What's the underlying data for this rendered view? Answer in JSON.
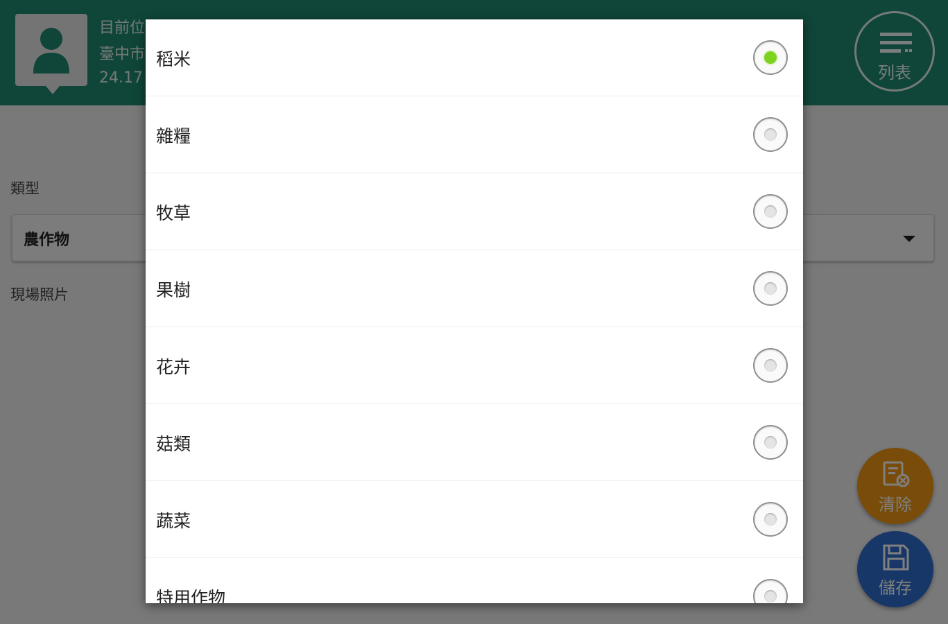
{
  "header": {
    "location_line1": "目前位置",
    "location_line2": "臺中市",
    "location_line3": "24.17",
    "list_button_label": "列表"
  },
  "form": {
    "type_label": "類型",
    "type_value": "農作物",
    "photo_label": "現場照片"
  },
  "fabs": {
    "clear_label": "清除",
    "save_label": "儲存"
  },
  "dialog": {
    "selected_index": 0,
    "options": [
      {
        "label": "稻米",
        "checked": true
      },
      {
        "label": "雜糧",
        "checked": false
      },
      {
        "label": "牧草",
        "checked": false
      },
      {
        "label": "果樹",
        "checked": false
      },
      {
        "label": "花卉",
        "checked": false
      },
      {
        "label": "菇類",
        "checked": false
      },
      {
        "label": "蔬菜",
        "checked": false
      },
      {
        "label": "特用作物",
        "checked": false
      }
    ]
  },
  "colors": {
    "header": "#1f8c72",
    "clear_fab": "#f39a12",
    "save_fab": "#2f6ed1",
    "radio_selected": "#7ed321"
  },
  "icons": {
    "avatar": "person-icon",
    "list": "list-icon",
    "clear": "clear-form-icon",
    "save": "floppy-disk-icon",
    "dropdown": "caret-down-icon"
  }
}
